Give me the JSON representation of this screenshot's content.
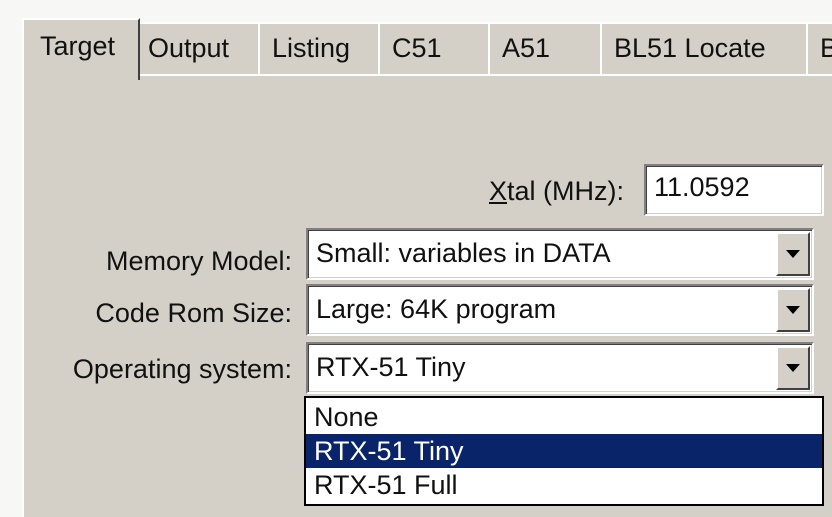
{
  "tabs": [
    {
      "label": "Target",
      "active": true
    },
    {
      "label": "Output",
      "active": false
    },
    {
      "label": "Listing",
      "active": false
    },
    {
      "label": "C51",
      "active": false
    },
    {
      "label": "A51",
      "active": false
    },
    {
      "label": "BL51 Locate",
      "active": false
    },
    {
      "label": "BL",
      "active": false
    }
  ],
  "xtal": {
    "label_underlined": "X",
    "label_rest": "tal (MHz):",
    "value": "11.0592"
  },
  "memory_model": {
    "label": "Memory Model:",
    "value": "Small: variables in DATA"
  },
  "code_rom_size": {
    "label": "Code Rom Size:",
    "value": "Large: 64K program"
  },
  "operating_system": {
    "label": "Operating system:",
    "value": "RTX-51 Tiny",
    "options": [
      "None",
      "RTX-51 Tiny",
      "RTX-51 Full"
    ],
    "highlighted_option": "RTX-51 Tiny"
  },
  "colors": {
    "dialog_face": "#d4d0c8",
    "selection": "#0a246a"
  }
}
